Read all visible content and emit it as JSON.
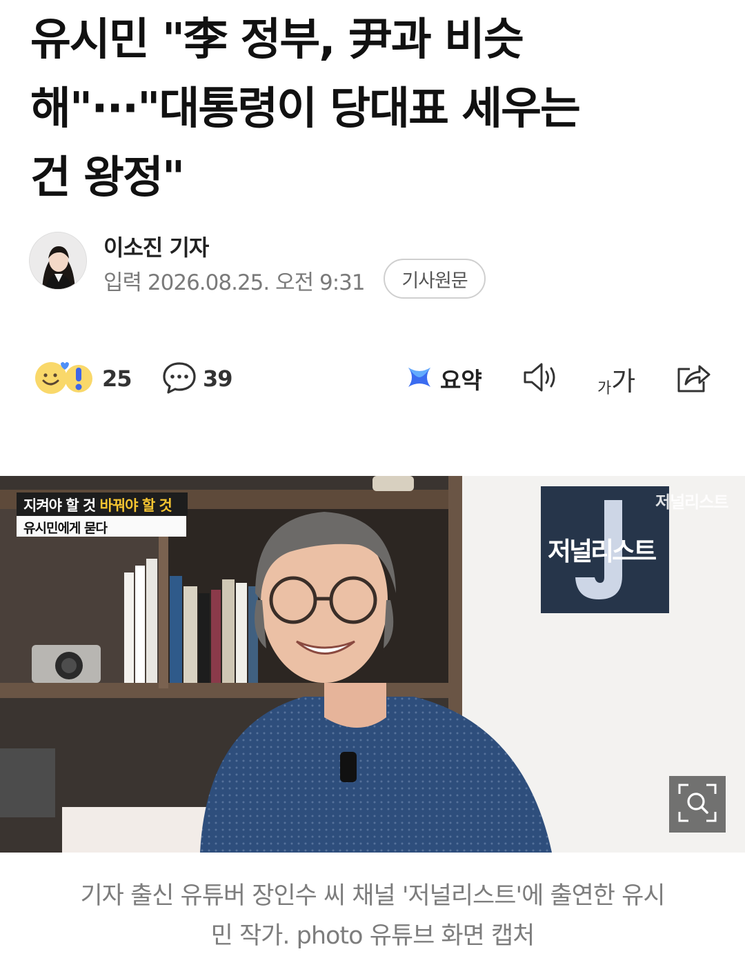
{
  "article": {
    "headline_line1": "유시민 \"李 정부, 尹과 비슷",
    "headline_line2": "해\"···\"대통령이 당대표 세우는",
    "headline_line3": "건 왕정\"",
    "reporter": "이소진 기자",
    "published": "입력 2026.08.25. 오전 9:31",
    "original_button": "기사원문"
  },
  "toolbar": {
    "reaction_count": "25",
    "comment_count": "39",
    "summary_label": "요약",
    "font_size_small": "가",
    "font_size_large": "가",
    "icons": [
      "reaction-emoji-icon",
      "comment-icon",
      "summary-icon",
      "speaker-icon",
      "text-size-icon",
      "share-icon"
    ]
  },
  "photo": {
    "overlay_line1_white": "지켜야 할 것 ",
    "overlay_line1_yellow": "바꿔야 할 것",
    "overlay_line2": "유시민에게 묻다",
    "board_logo_text": "저널리스트",
    "watermark": "저널리스트",
    "zoom_icon": "zoom-search-icon"
  },
  "caption": {
    "line1": "기자 출신 유튜버 장인수 씨 채널 '저널리스트'에 출연한 유시",
    "line2": "민 작가. photo 유튜브 화면 캡처"
  },
  "colors": {
    "accent_summary": "#3b6cf0",
    "overlay_yellow": "#f6c531",
    "logo_board": "#26354a",
    "caption_gray": "#7d7d7d"
  }
}
